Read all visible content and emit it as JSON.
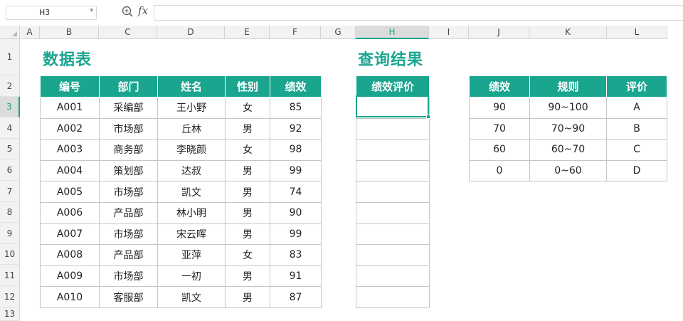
{
  "formula_bar": {
    "name_box": "H3",
    "formula": "",
    "fx_label": "fx"
  },
  "columns": [
    "A",
    "B",
    "C",
    "D",
    "E",
    "F",
    "G",
    "H",
    "I",
    "J",
    "K",
    "L"
  ],
  "rows": [
    "1",
    "2",
    "3",
    "4",
    "5",
    "6",
    "7",
    "8",
    "9",
    "10",
    "11",
    "12",
    "13"
  ],
  "active_cell": {
    "column": "H",
    "row": "3"
  },
  "data_table": {
    "title": "数据表",
    "headers": [
      "编号",
      "部门",
      "姓名",
      "性别",
      "绩效"
    ],
    "rows": [
      [
        "A001",
        "采编部",
        "王小野",
        "女",
        "85"
      ],
      [
        "A002",
        "市场部",
        "丘林",
        "男",
        "92"
      ],
      [
        "A003",
        "商务部",
        "李晓颜",
        "女",
        "98"
      ],
      [
        "A004",
        "策划部",
        "达叔",
        "男",
        "99"
      ],
      [
        "A005",
        "市场部",
        "凯文",
        "男",
        "74"
      ],
      [
        "A006",
        "产品部",
        "林小明",
        "男",
        "90"
      ],
      [
        "A007",
        "市场部",
        "宋云晖",
        "男",
        "99"
      ],
      [
        "A008",
        "产品部",
        "亚萍",
        "女",
        "83"
      ],
      [
        "A009",
        "市场部",
        "一初",
        "男",
        "91"
      ],
      [
        "A010",
        "客服部",
        "凯文",
        "男",
        "87"
      ]
    ]
  },
  "result_table": {
    "title": "查询结果",
    "header": "绩效评价",
    "values": [
      "",
      "",
      "",
      "",
      "",
      "",
      "",
      "",
      "",
      ""
    ]
  },
  "rule_table": {
    "headers": [
      "绩效",
      "规则",
      "评价"
    ],
    "rows": [
      [
        "90",
        "90~100",
        "A"
      ],
      [
        "70",
        "70~90",
        "B"
      ],
      [
        "60",
        "60~70",
        "C"
      ],
      [
        "0",
        "0~60",
        "D"
      ]
    ]
  },
  "colors": {
    "accent": "#1aa58f",
    "header_bg": "#f2f2f2",
    "grid": "#c6c6c6"
  }
}
